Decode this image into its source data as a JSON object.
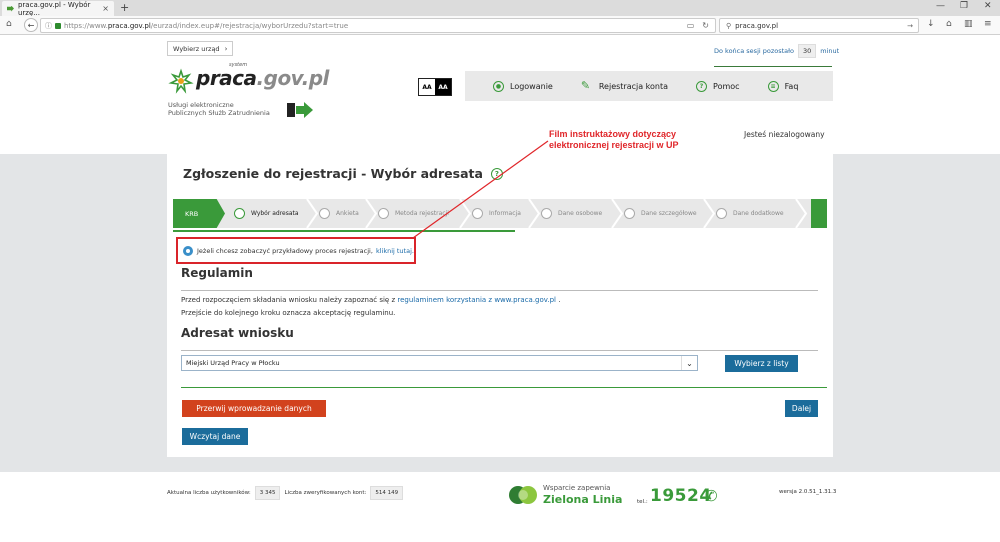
{
  "browser": {
    "tab_title": "praca.gov.pl - Wybór urzę...",
    "tab_close": "×",
    "new_tab": "+",
    "url_prefix": "https://www.",
    "url_host": "praca.gov.pl",
    "url_path": "/eurzad/index.eup#/rejestracja/wyborUrzedu?start=true",
    "search_value": "praca.gov.pl"
  },
  "header": {
    "choose_office": "Wybierz urząd",
    "session_label": "Do końca sesji pozostało",
    "session_value": "30",
    "session_unit": "minut",
    "logo_small": "system",
    "logo_main": "praca",
    "logo_domain": ".gov.pl",
    "subtitle_line1": "Usługi elektroniczne",
    "subtitle_line2": "Publicznych Służb Zatrudnienia",
    "aa_small": "AA",
    "aa_large": "AA",
    "nav": [
      {
        "label": "Logowanie"
      },
      {
        "label": "Rejestracja konta"
      },
      {
        "label": "Pomoc"
      },
      {
        "label": "Faq"
      }
    ],
    "user_status": "Jesteś niezalogowany"
  },
  "annotation": {
    "line1": "Film instruktażowy dotyczący",
    "line2": "elektronicznej rejestracji w UP",
    "color": "#e0262a"
  },
  "main": {
    "title": "Zgłoszenie do rejestracji - Wybór adresata",
    "steps": [
      {
        "label": "KRB"
      },
      {
        "label": "Wybór adresata"
      },
      {
        "label": "Ankieta"
      },
      {
        "label": "Metoda rejestracji"
      },
      {
        "label": "Informacja"
      },
      {
        "label": "Dane osobowe"
      },
      {
        "label": "Dane szczegółowe"
      },
      {
        "label": "Dane dodatkowe"
      }
    ],
    "film_text": "Jeżeli chcesz zobaczyć przykładowy proces rejestracji,",
    "film_link": "kliknij tutaj.",
    "regulamin_heading": "Regulamin",
    "regulamin_text_before": "Przed rozpoczęciem składania wniosku należy zapoznać się z",
    "regulamin_link": "regulaminem korzystania z www.praca.gov.pl",
    "regulamin_text_after": ".",
    "regulamin_line2": "Przejście do kolejnego kroku oznacza akceptację regulaminu.",
    "adresat_heading": "Adresat wniosku",
    "adresat_selected": "Miejski Urząd Pracy w Płocku",
    "choose_from_list": "Wybierz z listy",
    "cancel_button": "Przerwij wprowadzanie danych",
    "next_button": "Dalej",
    "load_button": "Wczytaj dane"
  },
  "footer": {
    "users_label": "Aktualna liczba użytkowników:",
    "users_value": "3 345",
    "verified_label": "Liczba zweryfikowanych kont:",
    "verified_value": "514 149",
    "support_line1": "Wsparcie zapewnia",
    "support_line2": "Zielona Linia",
    "tel_label": "tel.:",
    "tel_number": "19524",
    "version": "wersja 2.0.51_1.31.3"
  },
  "colors": {
    "brand_green": "#3a9a3a",
    "link_blue": "#1a6aa8",
    "button_blue": "#1b6c9b",
    "button_red": "#d2421d"
  }
}
